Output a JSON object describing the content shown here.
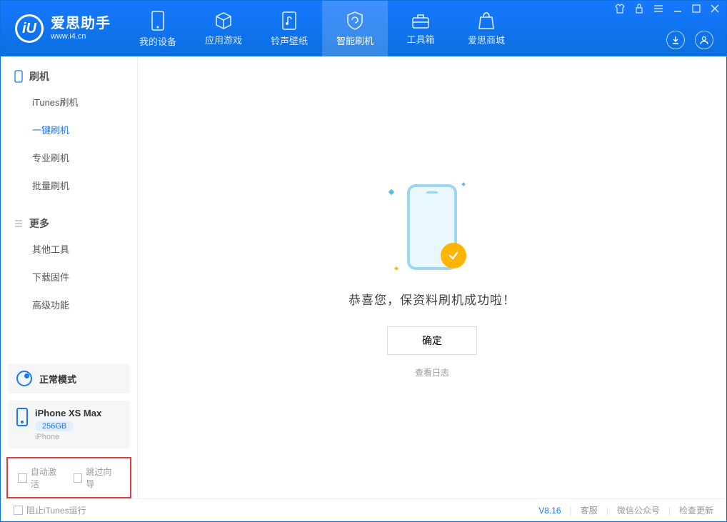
{
  "brand": {
    "title": "爱思助手",
    "subtitle": "www.i4.cn",
    "logo_letter": "iU"
  },
  "header_tabs": [
    {
      "label": "我的设备"
    },
    {
      "label": "应用游戏"
    },
    {
      "label": "铃声壁纸"
    },
    {
      "label": "智能刷机",
      "active": true
    },
    {
      "label": "工具箱"
    },
    {
      "label": "爱思商城"
    }
  ],
  "sidebar": {
    "section1_title": "刷机",
    "items1": [
      "iTunes刷机",
      "一键刷机",
      "专业刷机",
      "批量刷机"
    ],
    "active_item": "一键刷机",
    "section2_title": "更多",
    "items2": [
      "其他工具",
      "下载固件",
      "高级功能"
    ]
  },
  "mode_card": {
    "label": "正常模式"
  },
  "device_card": {
    "name": "iPhone XS Max",
    "storage": "256GB",
    "type": "iPhone"
  },
  "checkbox_row": {
    "cb1": "自动激活",
    "cb2": "跳过向导"
  },
  "main": {
    "success_message": "恭喜您，保资料刷机成功啦！",
    "ok_button": "确定",
    "log_link": "查看日志"
  },
  "footer": {
    "stop_itunes": "阻止iTunes运行",
    "version": "V8.16",
    "link1": "客服",
    "link2": "微信公众号",
    "link3": "检查更新"
  }
}
